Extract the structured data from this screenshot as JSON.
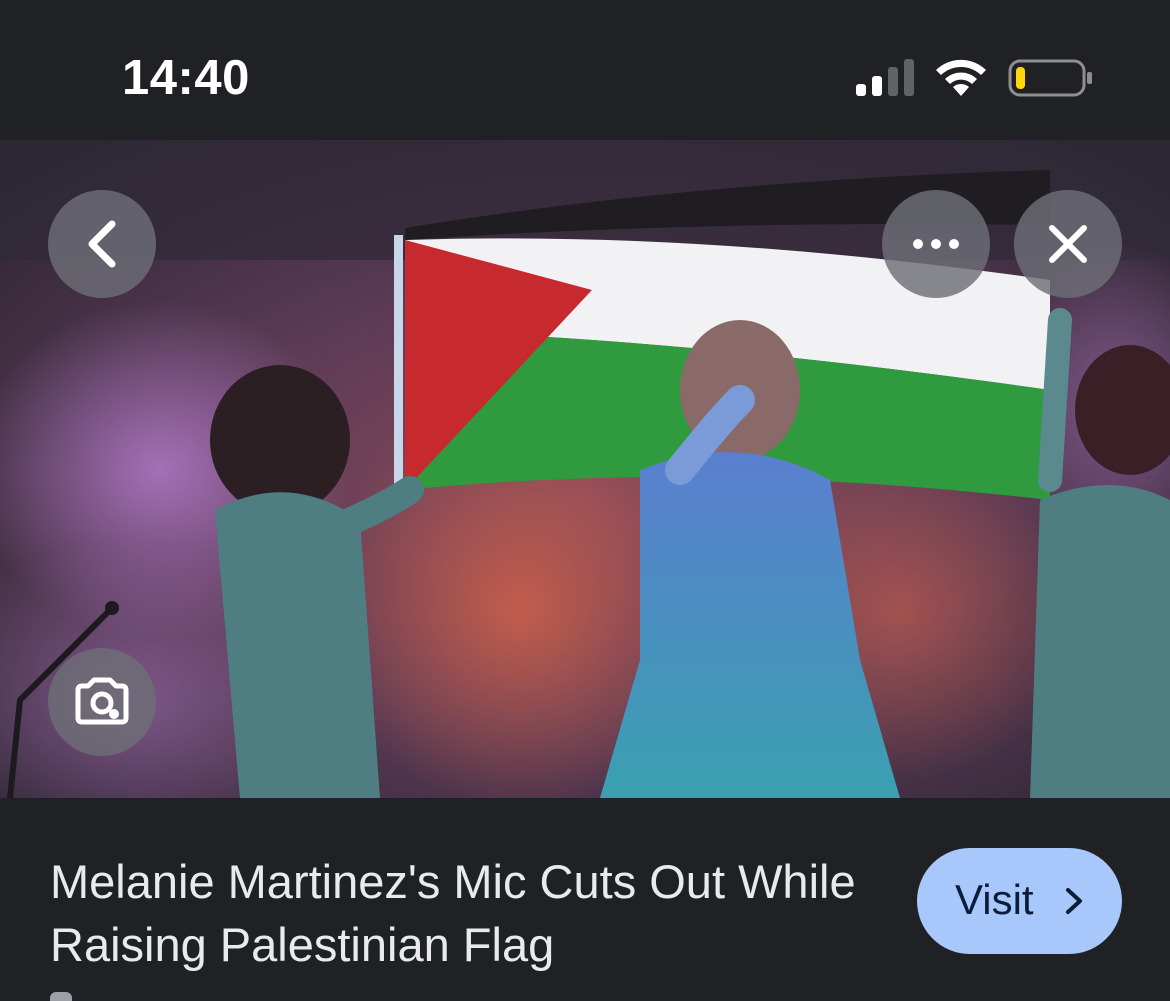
{
  "status_bar": {
    "time": "14:40",
    "icons": [
      "cellular-signal-icon",
      "wifi-icon",
      "battery-low-icon"
    ],
    "battery_color": "#ffd60a"
  },
  "image_viewer": {
    "controls": {
      "back": "chevron-left-icon",
      "more": "more-horizontal-icon",
      "close": "close-icon",
      "lens": "google-lens-icon"
    },
    "image_description_colors": {
      "flag_red": "#c62a2f",
      "flag_white": "#f2f2f4",
      "flag_green": "#2f9a3e"
    }
  },
  "result": {
    "title": "Melanie Martinez's Mic Cuts Out While Raising Palestinian Flag",
    "visit_label": "Visit",
    "visit_icon": "chevron-right-icon",
    "accent_color": "#a8c7fa"
  }
}
